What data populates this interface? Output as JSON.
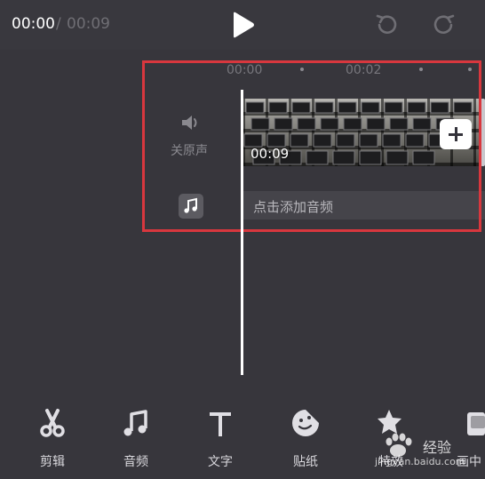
{
  "header": {
    "time_current": "00:00",
    "time_separator": "/",
    "time_total": "00:09",
    "play_icon": "play-icon",
    "undo_icon": "undo-icon",
    "redo_icon": "redo-icon"
  },
  "ruler": {
    "labels": [
      "00:00",
      "00:02"
    ]
  },
  "tracks": {
    "mute_label": "关原声",
    "mute_icon": "speaker-icon",
    "music_icon": "music-note-icon",
    "clip_duration": "00:09",
    "add_clip_icon": "plus-icon",
    "audio_placeholder": "点击添加音频"
  },
  "toolbar": {
    "items": [
      {
        "label": "剪辑",
        "icon": "scissors-icon"
      },
      {
        "label": "音频",
        "icon": "music-note-icon"
      },
      {
        "label": "文字",
        "icon": "text-t-icon"
      },
      {
        "label": "贴纸",
        "icon": "sticker-icon"
      },
      {
        "label": "特效",
        "icon": "star-effect-icon"
      },
      {
        "label": "画中",
        "icon": "picture-in-picture-icon"
      }
    ]
  },
  "watermark": {
    "brand": "经验",
    "url": "jingyan.baidu.com"
  },
  "colors": {
    "background": "#37363c",
    "highlight": "#d8373e",
    "text_primary": "#ffffff",
    "text_muted": "#6f6e74"
  }
}
